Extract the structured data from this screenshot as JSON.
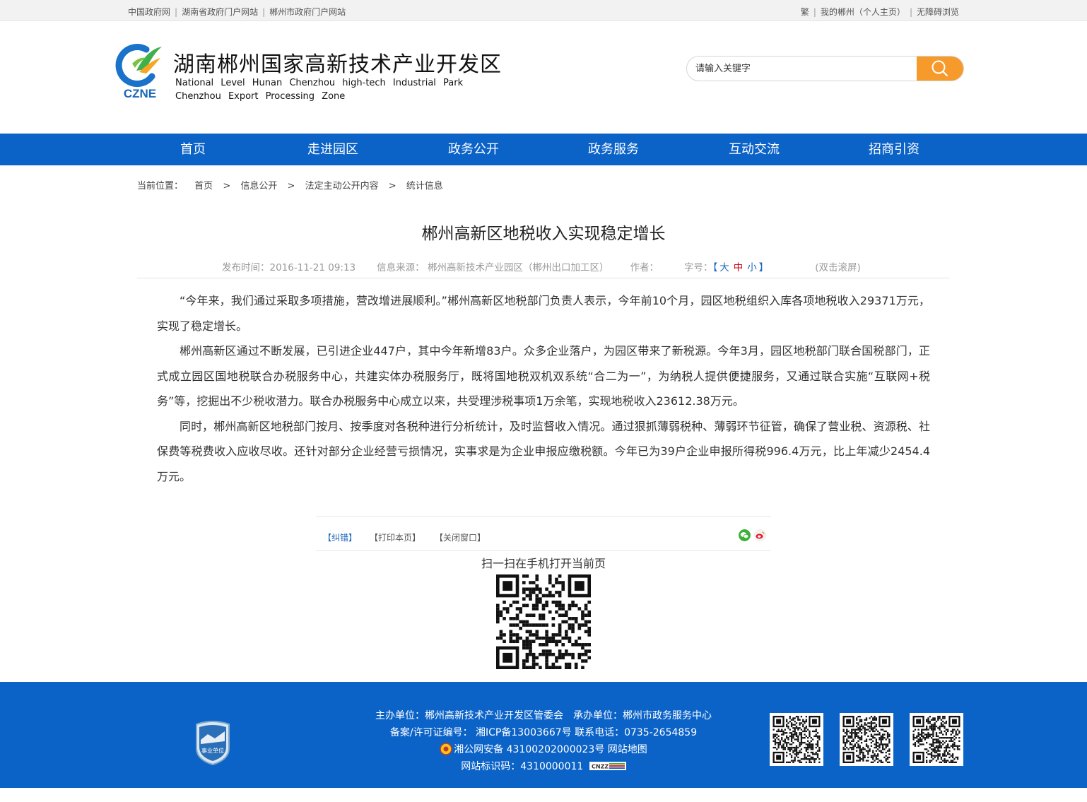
{
  "topbar": {
    "left_links": [
      "中国政府网",
      "湖南省政府门户网站",
      "郴州市政府门户网站"
    ],
    "right_links": [
      "繁",
      "我的郴州（个人主页）",
      "无障碍浏览"
    ]
  },
  "header": {
    "logo_text": "CZNE",
    "title_cn": "湖南郴州国家高新技术产业开发区",
    "title_en_line1": "National Level Hunan Chenzhou high-tech Industrial Park",
    "title_en_line2": "Chenzhou Export Processing Zone",
    "search_placeholder": "请输入关键字",
    "search_icon": "search-icon"
  },
  "nav": {
    "items": [
      "首页",
      "走进园区",
      "政务公开",
      "政务服务",
      "互动交流",
      "招商引资"
    ]
  },
  "breadcrumb": {
    "label": "当前位置：",
    "items": [
      "首页",
      "信息公开",
      "法定主动公开内容",
      "统计信息"
    ],
    "separator": ">"
  },
  "article": {
    "title": "郴州高新区地税收入实现稳定增长",
    "meta": {
      "publish_time": "发布时间：2016-11-21 09:13",
      "source": "信息来源： 郴州高新技术产业园区（郴州出口加工区）",
      "author": "作者：",
      "font_size_label": "字号：",
      "font_open": "【",
      "font_large": "大",
      "font_medium": "中",
      "font_small": "小",
      "font_close": "】",
      "dblclick": "(双击滚屏)"
    },
    "paragraphs": [
      "“今年来，我们通过采取多项措施，营改增进展顺利。”郴州高新区地税部门负责人表示，今年前10个月，园区地税组织入库各项地税收入29371万元，实现了稳定增长。",
      "郴州高新区通过不断发展，已引进企业447户，其中今年新增83户。众多企业落户，为园区带来了新税源。今年3月，园区地税部门联合国税部门，正式成立园区国地税联合办税服务中心，共建实体办税服务厅，既将国地税双机双系统“合二为一”，为纳税人提供便捷服务，又通过联合实施“互联网+税务”等，挖掘出不少税收潜力。联合办税服务中心成立以来，共受理涉税事项1万余笔，实现地税收入23612.38万元。",
      "同时，郴州高新区地税部门按月、按季度对各税种进行分析统计，及时监督收入情况。通过狠抓薄弱税种、薄弱环节征管，确保了营业税、资源税、社保费等税费收入应收尽收。还针对部分企业经营亏损情况，实事求是为企业申报应缴税额。今年已为39户企业申报所得税996.4万元，比上年减少2454.4万元。"
    ]
  },
  "tools": {
    "correct": "【纠错】",
    "print": "【打印本页】",
    "close": "【关闭窗口】",
    "share_icons": [
      "wechat-icon",
      "weibo-icon"
    ]
  },
  "qr": {
    "title": "扫一扫在手机打开当前页"
  },
  "footer": {
    "badge_text": "事业单位",
    "line1": "主办单位：郴州高新技术产业开发区管委会　承办单位：郴州市政务服务中心",
    "line2": "备案/许可证编号： 湘ICP备13003667号 联系电话：0735-2654859",
    "line3": "湘公网安备 43100202000023号 网站地图",
    "line4": "网站标识码：4310000011",
    "cnzz": "CNZZ"
  },
  "colors": {
    "primary_blue": "#0b63c8",
    "search_orange": "#f79a2c"
  }
}
